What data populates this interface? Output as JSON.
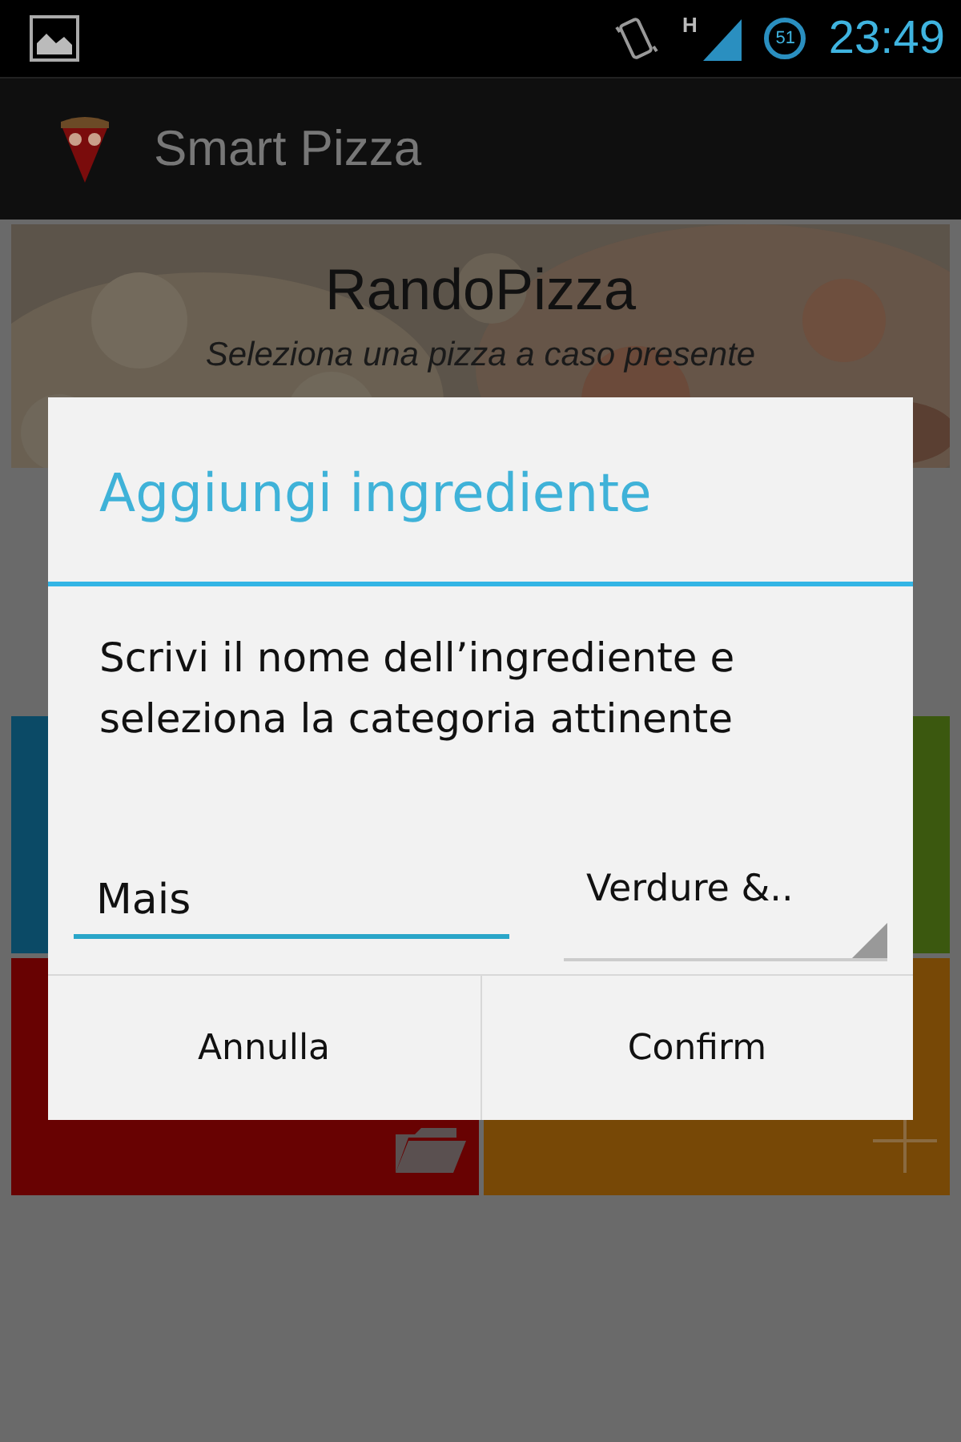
{
  "status_bar": {
    "network_type": "H",
    "battery_text": "51",
    "time": "23:49"
  },
  "app_bar": {
    "title": "Smart Pizza"
  },
  "header": {
    "title": "RandoPizza",
    "subtitle": "Seleziona una pizza a caso presente"
  },
  "tiles": [
    {
      "color": "#0b4a66",
      "kind": "plain"
    },
    {
      "color": "#3b580f",
      "kind": "plain"
    },
    {
      "color": "#680202",
      "kind": "folder"
    },
    {
      "color": "#774806",
      "kind": "plus"
    }
  ],
  "dialog": {
    "title": "Aggiungi ingrediente",
    "message": "Scrivi il nome dell’ingrediente e seleziona la categoria attinente",
    "name_field": {
      "value": "Mais"
    },
    "category_spinner": {
      "value": "Verdure &.."
    },
    "buttons": [
      {
        "label": "Annulla"
      },
      {
        "label": "Confirm"
      }
    ]
  }
}
